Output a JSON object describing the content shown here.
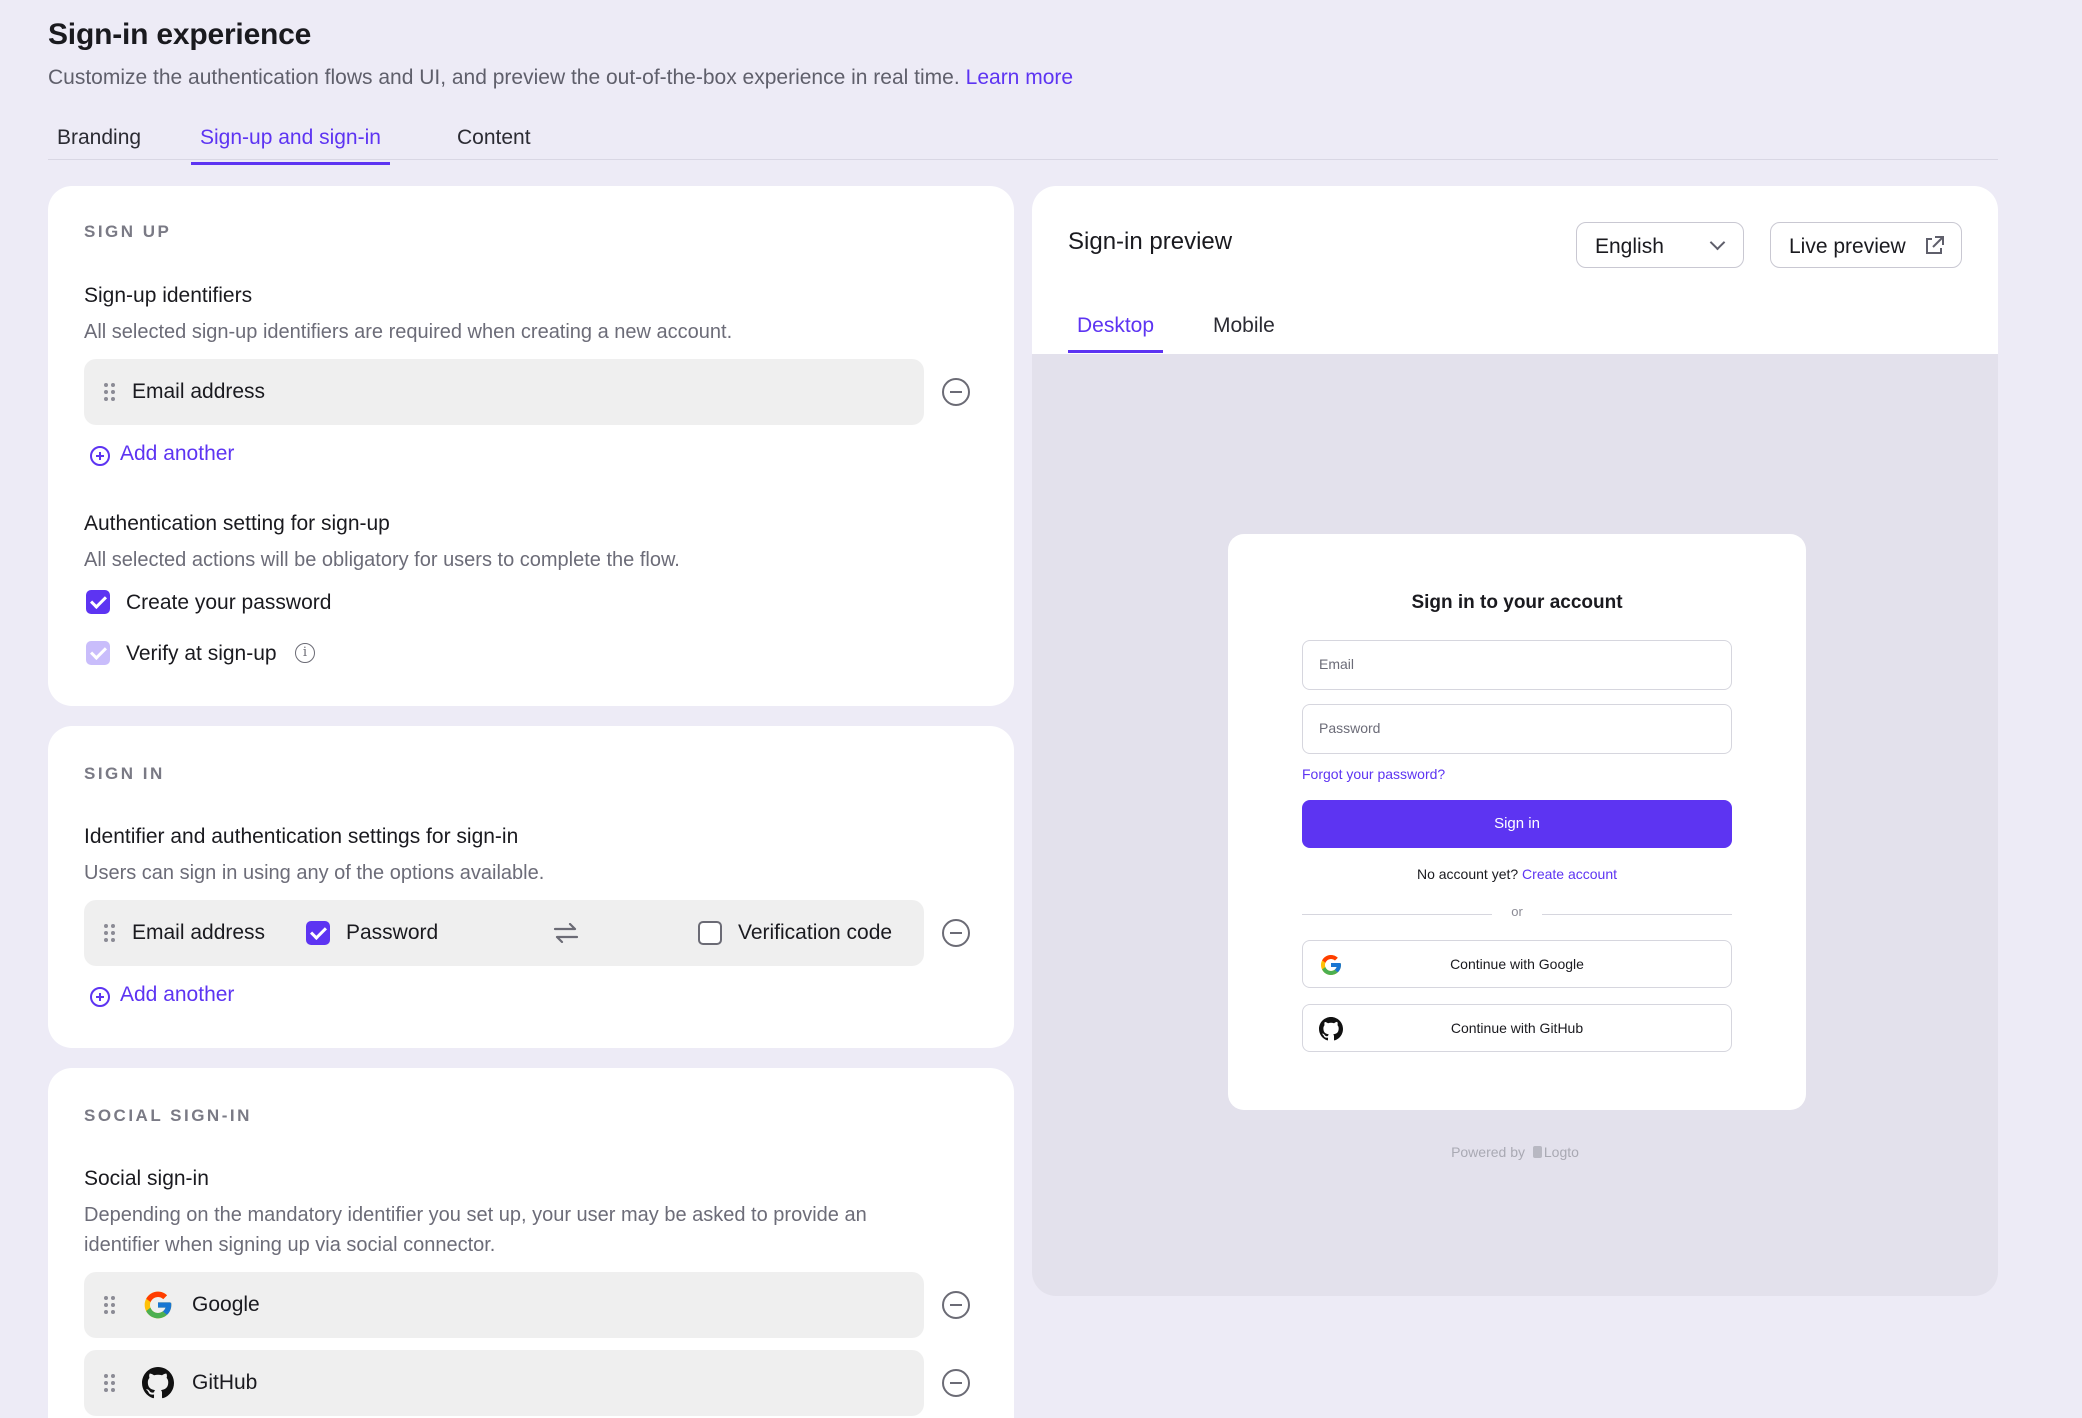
{
  "header": {
    "title": "Sign-in experience",
    "subtitle": "Customize the authentication flows and UI, and preview the out-of-the-box experience in real time.",
    "learn_more": "Learn more"
  },
  "tabs": [
    {
      "label": "Branding",
      "active": false
    },
    {
      "label": "Sign-up and sign-in",
      "active": true
    },
    {
      "label": "Content",
      "active": false
    }
  ],
  "sign_up": {
    "section_label": "SIGN UP",
    "identifiers_title": "Sign-up identifiers",
    "identifiers_desc": "All selected sign-up identifiers are required when creating a new account.",
    "identifier": "Email address",
    "add_another": "Add another",
    "auth_title": "Authentication setting for sign-up",
    "auth_desc": "All selected actions will be obligatory for users to complete the flow.",
    "create_password": {
      "label": "Create your password",
      "checked": true
    },
    "verify": {
      "label": "Verify at sign-up",
      "checked": true,
      "disabled": true
    }
  },
  "sign_in": {
    "section_label": "SIGN IN",
    "title": "Identifier and authentication settings for sign-in",
    "desc": "Users can sign in using any of the options available.",
    "identifier": "Email address",
    "password": {
      "label": "Password",
      "checked": true
    },
    "verification": {
      "label": "Verification code",
      "checked": false
    },
    "add_another": "Add another"
  },
  "social": {
    "section_label": "SOCIAL SIGN-IN",
    "title": "Social sign-in",
    "desc_line1": "Depending on the mandatory identifier you set up, your user may be asked to provide an",
    "desc_line2": "identifier when signing up via social connector.",
    "connectors": [
      "Google",
      "GitHub"
    ]
  },
  "preview": {
    "title": "Sign-in preview",
    "language": "English",
    "live_preview": "Live preview",
    "tabs": [
      {
        "label": "Desktop",
        "active": true
      },
      {
        "label": "Mobile",
        "active": false
      }
    ],
    "mock": {
      "title": "Sign in to your account",
      "email_placeholder": "Email",
      "password_placeholder": "Password",
      "forgot": "Forgot your password?",
      "sign_in": "Sign in",
      "no_account": "No account yet?",
      "create_account": "Create account",
      "or": "or",
      "google": "Continue with Google",
      "github": "Continue with GitHub"
    },
    "powered_by": "Powered by",
    "powered_brand": "Logto"
  },
  "colors": {
    "accent": "#5d34f2",
    "page_bg": "#edebf6",
    "preview_bg": "#e3e1ec"
  }
}
